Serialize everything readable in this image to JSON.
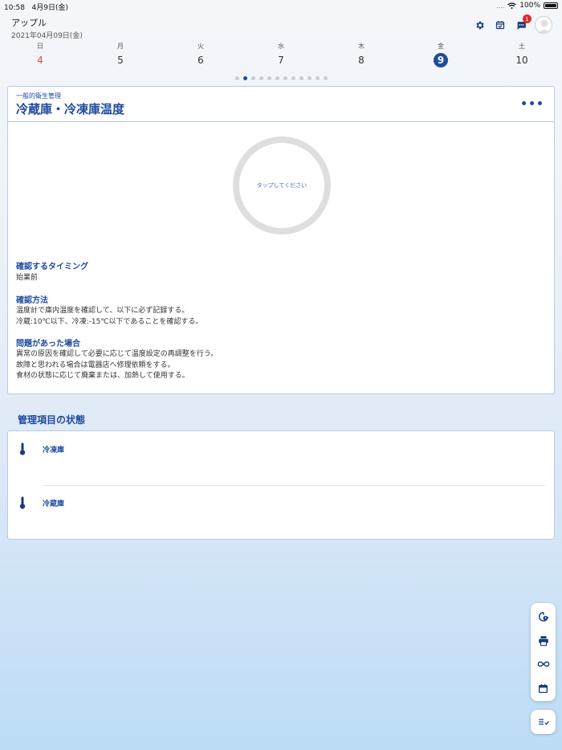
{
  "status_bar": {
    "time": "10:58",
    "date": "4月9日(金)",
    "signal": "....",
    "battery": "100%"
  },
  "header": {
    "store_name": "アップル",
    "date": "2021年04月09日(金)",
    "notification_count": "1"
  },
  "week": [
    {
      "name": "日",
      "num": "4",
      "sunday": true
    },
    {
      "name": "月",
      "num": "5"
    },
    {
      "name": "火",
      "num": "6"
    },
    {
      "name": "水",
      "num": "7"
    },
    {
      "name": "木",
      "num": "8"
    },
    {
      "name": "金",
      "num": "9",
      "selected": true
    },
    {
      "name": "土",
      "num": "10"
    }
  ],
  "pager": {
    "count": 12,
    "active_index": 1
  },
  "task_card": {
    "category": "一般的衛生管理",
    "title": "冷蔵庫・冷凍庫温度",
    "ring_prompt": "タップしてください",
    "timing_label": "確認するタイミング",
    "timing_text": "始業前",
    "method_label": "確認方法",
    "method_lines": [
      "温度計で庫内温度を確認して、以下に必ず記録する。",
      "冷蔵:10℃以下、冷凍:-15℃以下であることを確認する。"
    ],
    "problem_label": "問題があった場合",
    "problem_lines": [
      "異常の原因を確認して必要に応じて温度設定の再調整を行う。",
      "故障と思われる場合は電器店へ修理依頼をする。",
      "食材の状態に応じて廃棄または、加熱して使用する。"
    ]
  },
  "status_section": {
    "heading": "管理項目の状態",
    "items": [
      {
        "label": "冷凍庫",
        "icon": "thermometer-icon"
      },
      {
        "label": "冷蔵庫",
        "icon": "thermometer-icon"
      }
    ]
  },
  "fab_icons": [
    "timer-icon",
    "print-icon",
    "infinity-icon",
    "calendar-icon",
    "checklist-icon"
  ],
  "colors": {
    "accent": "#1f4aa0",
    "sunday": "#e24b3a",
    "badge": "#e02b2b"
  }
}
